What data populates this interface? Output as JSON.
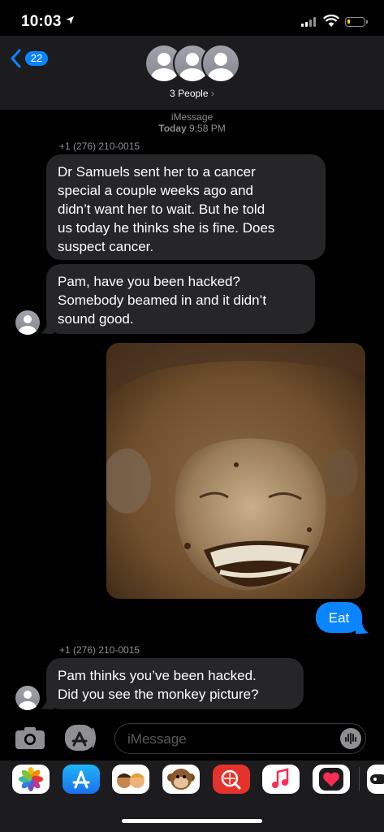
{
  "status": {
    "time": "10:03",
    "battery_color": "#ffd60a"
  },
  "header": {
    "back_count": "22",
    "people_label": "3 People",
    "people_chevron": "›",
    "accent": "#0a84ff"
  },
  "conversation": {
    "service": "iMessage",
    "date_day": "Today",
    "date_time": "9:58 PM",
    "messages": [
      {
        "direction": "incoming",
        "sender": "+1 (276) 210-0015",
        "lines": [
          "Dr Samuels sent her to a cancer",
          "special a couple weeks ago and",
          "didn’t want her to wait.  But he told",
          "us today he thinks she is fine.  Does",
          "suspect cancer."
        ]
      },
      {
        "direction": "incoming",
        "lines": [
          "Pam,  have you been hacked?",
          "Somebody beamed in and it didn’t",
          "sound good."
        ]
      },
      {
        "direction": "outgoing",
        "type": "image",
        "description": "photo-attachment"
      },
      {
        "direction": "outgoing",
        "text": "Eat"
      },
      {
        "direction": "incoming",
        "sender": "+1 (276) 210-0015",
        "lines": [
          "Pam thinks you’ve been hacked.",
          "Did you see the monkey picture?"
        ]
      }
    ]
  },
  "composer": {
    "placeholder": "iMessage"
  },
  "app_drawer": {
    "apps": [
      "photos-app-icon",
      "app-store-icon",
      "memoji-icon",
      "monkey-animoji-icon",
      "web-search-icon",
      "music-app-icon",
      "digital-touch-icon",
      "game-app-icon"
    ]
  }
}
